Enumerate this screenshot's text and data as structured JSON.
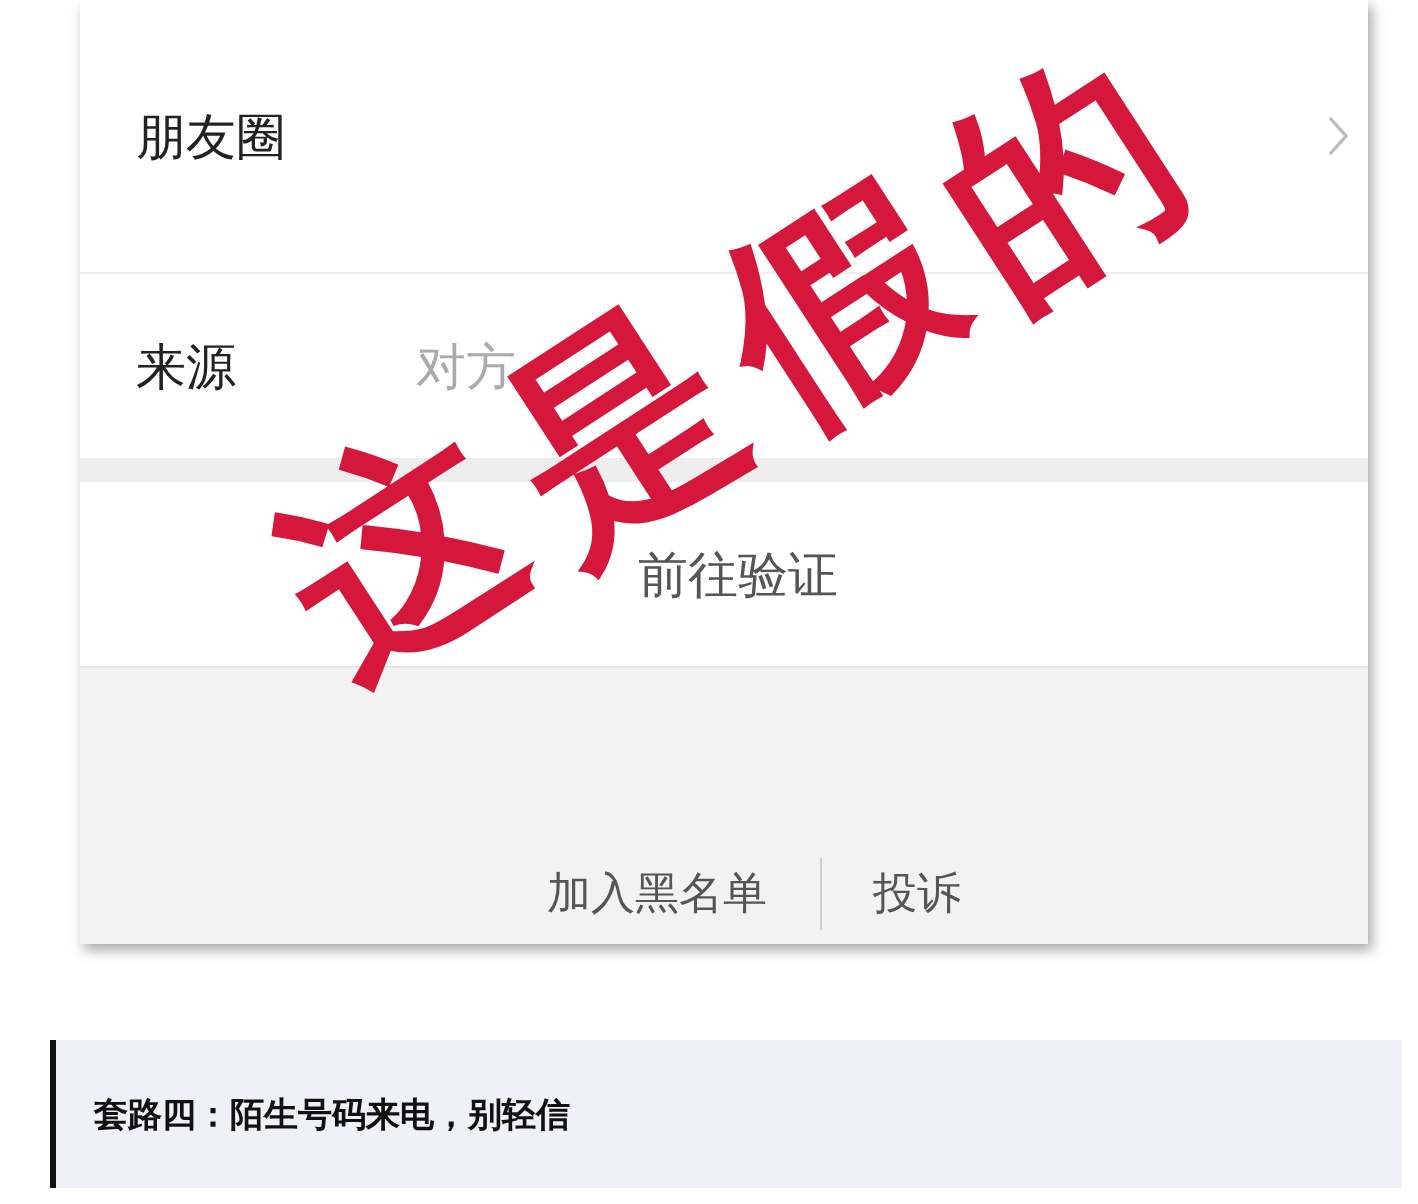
{
  "screenshot": {
    "rows": [
      {
        "kind": "link",
        "label": "朋友圈"
      },
      {
        "kind": "info",
        "label": "来源",
        "value": "对方"
      }
    ],
    "action": "前往验证",
    "bottom_actions": [
      "加入黑名单",
      "投诉"
    ],
    "stamp": "这是假的"
  },
  "heading": "套路四：陌生号码来电，别轻信"
}
